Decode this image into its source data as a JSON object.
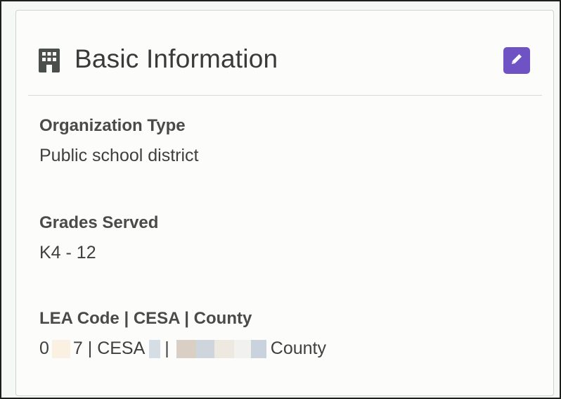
{
  "card": {
    "title": "Basic Information",
    "icons": {
      "header": "building-icon",
      "edit": "pencil-icon"
    },
    "accent_color": "#6f52c4"
  },
  "fields": [
    {
      "label": "Organization Type",
      "value": "Public school district"
    },
    {
      "label": "Grades Served",
      "value": "K4 - 12"
    },
    {
      "label": "LEA Code | CESA | County",
      "value_parts": {
        "lea_prefix": "0",
        "lea_suffix": "7 | CESA",
        "separator": "|",
        "county_suffix": "County"
      }
    }
  ]
}
